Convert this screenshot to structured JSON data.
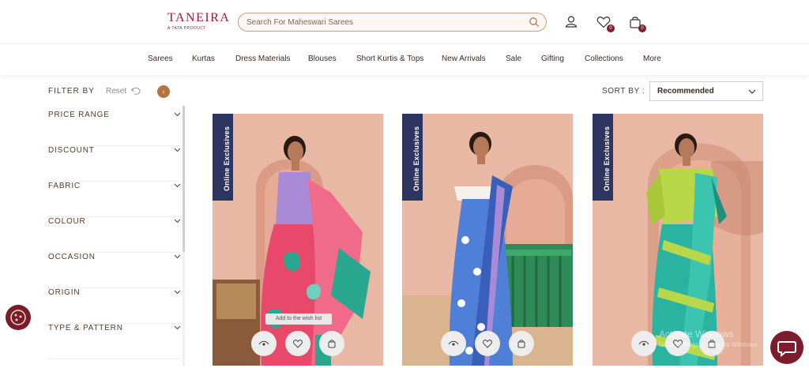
{
  "header": {
    "logo": "TANEIRA",
    "logo_sub": "A TATA PRODUCT",
    "search_placeholder": "Search For Maheswari Sarees",
    "wishlist_count": "0",
    "cart_count": "0"
  },
  "nav": {
    "items": [
      "Sarees",
      "Kurtas",
      "Dress Materials",
      "Blouses",
      "Short Kurtis & Tops",
      "New Arrivals",
      "Sale",
      "Gifting",
      "Collections",
      "More"
    ]
  },
  "filter": {
    "title": "FILTER BY",
    "reset": "Reset",
    "collapse_symbol": "‹",
    "items": [
      "PRICE RANGE",
      "DISCOUNT",
      "FABRIC",
      "COLOUR",
      "OCCASION",
      "ORIGIN",
      "TYPE & PATTERN"
    ]
  },
  "sort": {
    "label": "SORT BY :",
    "selected": "Recommended"
  },
  "products": [
    {
      "ribbon": "Online Exclusives",
      "tooltip": "Add to the wish list"
    },
    {
      "ribbon": "Online Exclusives"
    },
    {
      "ribbon": "Online Exclusives"
    }
  ],
  "overlay": {
    "watermark": "Activate Windows",
    "watermark_sub": "Go to Settings to activate Windows."
  },
  "colors": {
    "brand": "#9b1c3d",
    "accent": "#b8743f",
    "ribbon": "#2f3561"
  }
}
